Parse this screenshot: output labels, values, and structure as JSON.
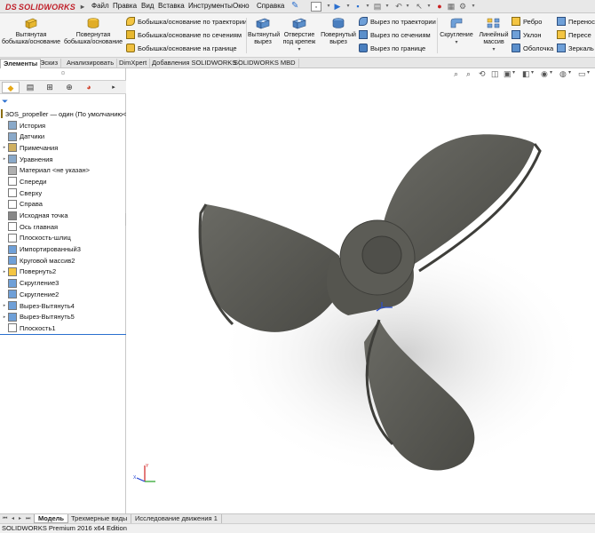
{
  "app": {
    "logo_text": "SOLIDWORKS",
    "logo_prefix": "DS"
  },
  "menu": [
    "Файл",
    "Правка",
    "Вид",
    "Вставка",
    "Инструменты",
    "Окно",
    "Справка"
  ],
  "command_manager": {
    "extruded_boss": "Вытянутая бобышка/основание",
    "revolved_boss": "Повернутая бобышка/основание",
    "swept_boss": "Бобышка/основание по траектории",
    "lofted_boss": "Бобышка/основание по сечениям",
    "boundary_boss": "Бобышка/основание на границе",
    "extruded_cut": "Вытянутый вырез",
    "hole_wizard": "Отверстие под крепеж",
    "revolved_cut": "Повернутый вырез",
    "swept_cut": "Вырез по траектории",
    "lofted_cut": "Вырез по сечениям",
    "boundary_cut": "Вырез по границе",
    "fillet": "Скругление",
    "linear_pattern": "Линейный массив",
    "rib": "Ребро",
    "draft": "Уклон",
    "shell": "Оболочка",
    "wrap": "Перенос",
    "intersect": "Пересе",
    "mirror": "Зеркаль"
  },
  "tabs": [
    "Элементы",
    "Эскиз",
    "Анализировать",
    "DimXpert",
    "Добавления SOLIDWORKS",
    "SOLIDWORKS MBD"
  ],
  "feature_tree": {
    "root": "3OS_propeller — один  (По умолчанию<",
    "items": [
      {
        "label": "История",
        "expandable": false
      },
      {
        "label": "Датчики",
        "expandable": false
      },
      {
        "label": "Примечания",
        "expandable": true
      },
      {
        "label": "Уравнения",
        "expandable": true
      },
      {
        "label": "Материал <не указан>",
        "expandable": false
      },
      {
        "label": "Спереди",
        "expandable": false
      },
      {
        "label": "Сверху",
        "expandable": false
      },
      {
        "label": "Справа",
        "expandable": false
      },
      {
        "label": "Исходная точка",
        "expandable": false
      },
      {
        "label": "Ось главная",
        "expandable": false
      },
      {
        "label": "Плоскость-шлиц",
        "expandable": false
      },
      {
        "label": "Импортированный3",
        "expandable": false
      },
      {
        "label": "Круговой массив2",
        "expandable": false
      },
      {
        "label": "Повернуть2",
        "expandable": true
      },
      {
        "label": "Скругление3",
        "expandable": false
      },
      {
        "label": "Скругление2",
        "expandable": false
      },
      {
        "label": "Вырез-Вытянуть4",
        "expandable": true
      },
      {
        "label": "Вырез-Вытянуть5",
        "expandable": true
      },
      {
        "label": "Плоскость1",
        "expandable": false
      }
    ]
  },
  "bottom_tabs": [
    "Модель",
    "Трехмерные виды",
    "Исследование движения 1"
  ],
  "status_bar": "SOLIDWORKS Premium 2016 x64 Edition",
  "colors": {
    "model": "#5a5a55",
    "accent": "#2a6fcf",
    "brand": "#c0202a"
  }
}
